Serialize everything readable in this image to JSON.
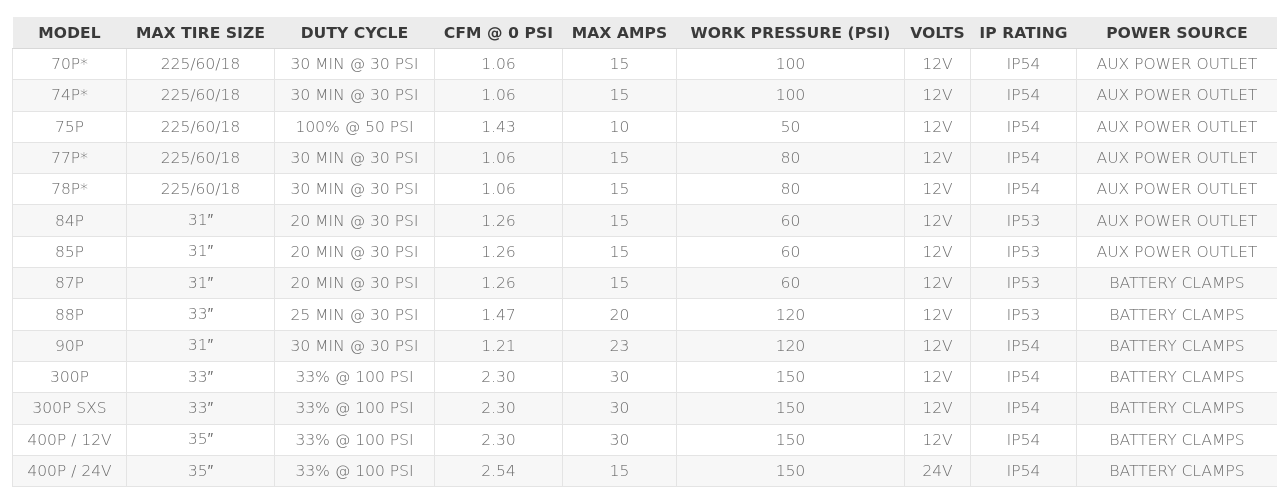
{
  "table": {
    "headers": [
      "MODEL",
      "MAX TIRE SIZE",
      "DUTY CYCLE",
      "CFM @ 0 PSI",
      "MAX AMPS",
      "WORK PRESSURE (PSI)",
      "VOLTS",
      "IP RATING",
      "POWER SOURCE"
    ],
    "rows": [
      [
        "70P*",
        "225/60/18",
        "30 MIN @ 30 PSI",
        "1.06",
        "15",
        "100",
        "12V",
        "IP54",
        "AUX POWER OUTLET"
      ],
      [
        "74P*",
        "225/60/18",
        "30 MIN @ 30 PSI",
        "1.06",
        "15",
        "100",
        "12V",
        "IP54",
        "AUX POWER OUTLET"
      ],
      [
        "75P",
        "225/60/18",
        "100% @ 50 PSI",
        "1.43",
        "10",
        "50",
        "12V",
        "IP54",
        "AUX POWER OUTLET"
      ],
      [
        "77P*",
        "225/60/18",
        "30 MIN @ 30 PSI",
        "1.06",
        "15",
        "80",
        "12V",
        "IP54",
        "AUX POWER OUTLET"
      ],
      [
        "78P*",
        "225/60/18",
        "30 MIN @ 30 PSI",
        "1.06",
        "15",
        "80",
        "12V",
        "IP54",
        "AUX POWER OUTLET"
      ],
      [
        "84P",
        "31″",
        "20 MIN @ 30 PSI",
        "1.26",
        "15",
        "60",
        "12V",
        "IP53",
        "AUX POWER OUTLET"
      ],
      [
        "85P",
        "31″",
        "20 MIN @ 30 PSI",
        "1.26",
        "15",
        "60",
        "12V",
        "IP53",
        "AUX POWER OUTLET"
      ],
      [
        "87P",
        "31″",
        "20 MIN @ 30 PSI",
        "1.26",
        "15",
        "60",
        "12V",
        "IP53",
        "BATTERY CLAMPS"
      ],
      [
        "88P",
        "33″",
        "25 MIN @ 30 PSI",
        "1.47",
        "20",
        "120",
        "12V",
        "IP53",
        "BATTERY CLAMPS"
      ],
      [
        "90P",
        "31″",
        "30 MIN @ 30 PSI",
        "1.21",
        "23",
        "120",
        "12V",
        "IP54",
        "BATTERY CLAMPS"
      ],
      [
        "300P",
        "33″",
        "33% @ 100 PSI",
        "2.30",
        "30",
        "150",
        "12V",
        "IP54",
        "BATTERY CLAMPS"
      ],
      [
        "300P SXS",
        "33″",
        "33% @ 100 PSI",
        "2.30",
        "30",
        "150",
        "12V",
        "IP54",
        "BATTERY CLAMPS"
      ],
      [
        "400P / 12V",
        "35″",
        "33% @ 100 PSI",
        "2.30",
        "30",
        "150",
        "12V",
        "IP54",
        "BATTERY CLAMPS"
      ],
      [
        "400P / 24V",
        "35″",
        "33% @ 100 PSI",
        "2.54",
        "15",
        "150",
        "24V",
        "IP54",
        "BATTERY CLAMPS"
      ]
    ]
  }
}
